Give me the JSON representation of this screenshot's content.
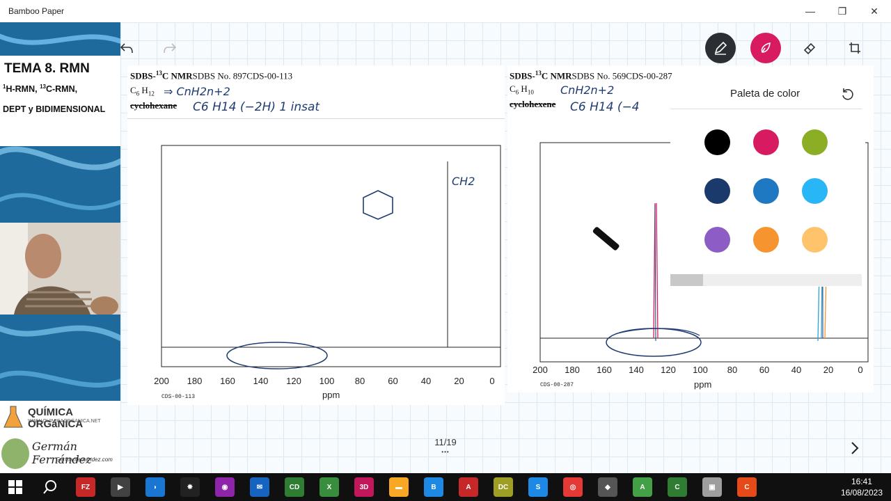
{
  "window": {
    "title": "Bamboo Paper",
    "minimize_glyph": "—",
    "restore_glyph": "❐",
    "close_glyph": "✕"
  },
  "sidebar": {
    "tema_title": "TEMA 8. RMN",
    "line1_prefix": "1",
    "line1_mid": "H-RMN, ",
    "line1_sup": "13",
    "line1_suffix": "C-RMN,",
    "line2": "DEPT y BIDIMENSIONAL",
    "brand_name": "QUÍMICA ORGáNICA",
    "brand_url": "WWW.QUIMICAORGANICA.NET",
    "author": "Germán Fernández",
    "author_site": "Germanfernandez.com"
  },
  "toolbar": {
    "undo_icon": "undo-icon",
    "redo_icon": "redo-icon",
    "pen_color": "#2b2f33",
    "highlighter_color": "#d81b60"
  },
  "spectrum_left": {
    "header_bold": "SDBS-",
    "header_sup": "13",
    "header_bold2": "C NMR",
    "header_rest": "SDBS No. 897CDS-00-113",
    "formula_base": "C",
    "formula_sub1": "6",
    "formula_mid": " H",
    "formula_sub2": "12",
    "name_struck": "cyclohexane",
    "hand_line1": "⇒ CnH2n+2",
    "hand_line2": "C6 H14  (−2H) 1 insat",
    "hand_label": "CH2",
    "xlabel": "ppm",
    "code": "CDS-00-113",
    "ticks": [
      "200",
      "180",
      "160",
      "140",
      "120",
      "100",
      "80",
      "60",
      "40",
      "20",
      "0"
    ]
  },
  "spectrum_right": {
    "header_bold": "SDBS-",
    "header_sup": "13",
    "header_bold2": "C NMR",
    "header_rest": "SDBS No. 569CDS-00-287",
    "formula_base": "C",
    "formula_sub1": "6",
    "formula_mid": " H",
    "formula_sub2": "10",
    "name_struck": "cyclohexene",
    "hand_line1": "CnH2n+2",
    "hand_line2": "C6 H14  (−4",
    "xlabel": "ppm",
    "code": "CDS-00-287",
    "ticks": [
      "200",
      "180",
      "160",
      "140",
      "120",
      "100",
      "80",
      "60",
      "40",
      "20",
      "0"
    ]
  },
  "palette": {
    "title": "Paleta de color",
    "reset_icon": "reset-icon",
    "colors": [
      "#000000",
      "#d81b60",
      "#8bae24",
      "#1a3a6b",
      "#1e78c2",
      "#29b6f6",
      "#8e5cc5",
      "#f6952f",
      "#ffc46b"
    ]
  },
  "pager": {
    "text": "11/19",
    "more": "•••"
  },
  "taskbar": {
    "time": "16:41",
    "date": "16/08/2023",
    "apps": [
      {
        "name": "filezilla",
        "label": "FZ",
        "color": "#c62828"
      },
      {
        "name": "media-player",
        "label": "▶",
        "color": "#424242"
      },
      {
        "name": "browser-2",
        "label": "◗",
        "color": "#1976d2"
      },
      {
        "name": "app-black",
        "label": "✸",
        "color": "#222222"
      },
      {
        "name": "color-app",
        "label": "◉",
        "color": "#8e24aa"
      },
      {
        "name": "mail",
        "label": "✉",
        "color": "#1565c0"
      },
      {
        "name": "cd-app",
        "label": "CD",
        "color": "#2e7d32"
      },
      {
        "name": "spreadsheet",
        "label": "X",
        "color": "#388e3c"
      },
      {
        "name": "paint-3d",
        "label": "3D",
        "color": "#c2185b"
      },
      {
        "name": "file-explorer",
        "label": "▬",
        "color": "#f9a825"
      },
      {
        "name": "bamboo-paper",
        "label": "B",
        "color": "#1e88e5"
      },
      {
        "name": "pdf-reader",
        "label": "A",
        "color": "#c62828"
      },
      {
        "name": "document-app",
        "label": "DC",
        "color": "#9e9d24"
      },
      {
        "name": "skype",
        "label": "S",
        "color": "#1e88e5"
      },
      {
        "name": "chrome",
        "label": "◎",
        "color": "#e53935"
      },
      {
        "name": "app-diamond",
        "label": "◆",
        "color": "#555555"
      },
      {
        "name": "android-studio",
        "label": "A",
        "color": "#43a047"
      },
      {
        "name": "camtasia",
        "label": "C",
        "color": "#2e7d32"
      },
      {
        "name": "app-grey",
        "label": "▣",
        "color": "#9e9e9e"
      },
      {
        "name": "camtasia-red",
        "label": "C",
        "color": "#e64a19"
      }
    ]
  }
}
